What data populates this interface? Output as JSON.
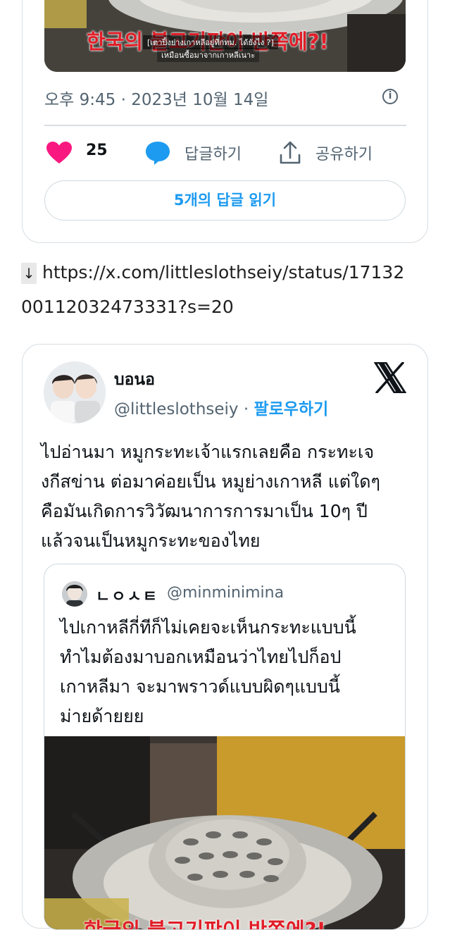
{
  "top_tweet": {
    "overlay_korean": "한국의 불고기판이 반쪽에?!",
    "overlay_thai": "[เตาปิ้งย่างเกาหลีอยู่ที่กทม. ได้ยังไง ?]",
    "overlay_thai_2": "เหมือนซื้อมาจากเกาหลีเนาะ",
    "timestamp": "오후 9:45 · 2023년 10월 14일",
    "like_count": "25",
    "reply_label": "답글하기",
    "share_label": "공유하기",
    "read_replies_label": "5개의 답글 읽기"
  },
  "link": {
    "arrow": "↓",
    "line1": "https://x.com/littleslothseiy/status/17132",
    "line2": "00112032473331?s=20"
  },
  "main_tweet": {
    "display_name": "บอนอ",
    "handle": "@littleslothseiy",
    "separator": " · ",
    "follow_label": "팔로우하기",
    "text_lines": [
      "ไปอ่านมา หมูกระทะเจ้าแรกเลยคือ กระทะเจ",
      "งกีสข่าน ต่อมาค่อยเป็น หมูย่างเกาหลี แต่ใดๆ",
      "คือมันเกิดการวิวัฒนาการการมาเป็น 10ๆ ปี",
      "แล้วจนเป็นหมูกระทะของไทย"
    ]
  },
  "quoted_tweet": {
    "display_name": "ㄴㅇㅅㅌ",
    "handle": "@minminimina",
    "text_lines": [
      "ไปเกาหลีกี่ทีก็ไม่เคยจะเห็นกระทะแบบนี้",
      "ทำไมต้องมาบอกเหมือนว่าไทยไปก็อป",
      "เกาหลีมา จะมาพราวด์แบบผิดๆแบบนี้",
      "ม่ายด้ายยย"
    ],
    "overlay_korean": "한국의 불고기판이 반쪽에?!"
  },
  "colors": {
    "accent": "#1d9bf0",
    "like": "#f91880",
    "muted": "#536471",
    "border": "#d7dde2",
    "overlay_red": "#e11d27"
  },
  "icons": [
    "heart-icon",
    "reply-icon",
    "share-icon",
    "info-icon",
    "x-logo-icon",
    "down-arrow-icon"
  ]
}
